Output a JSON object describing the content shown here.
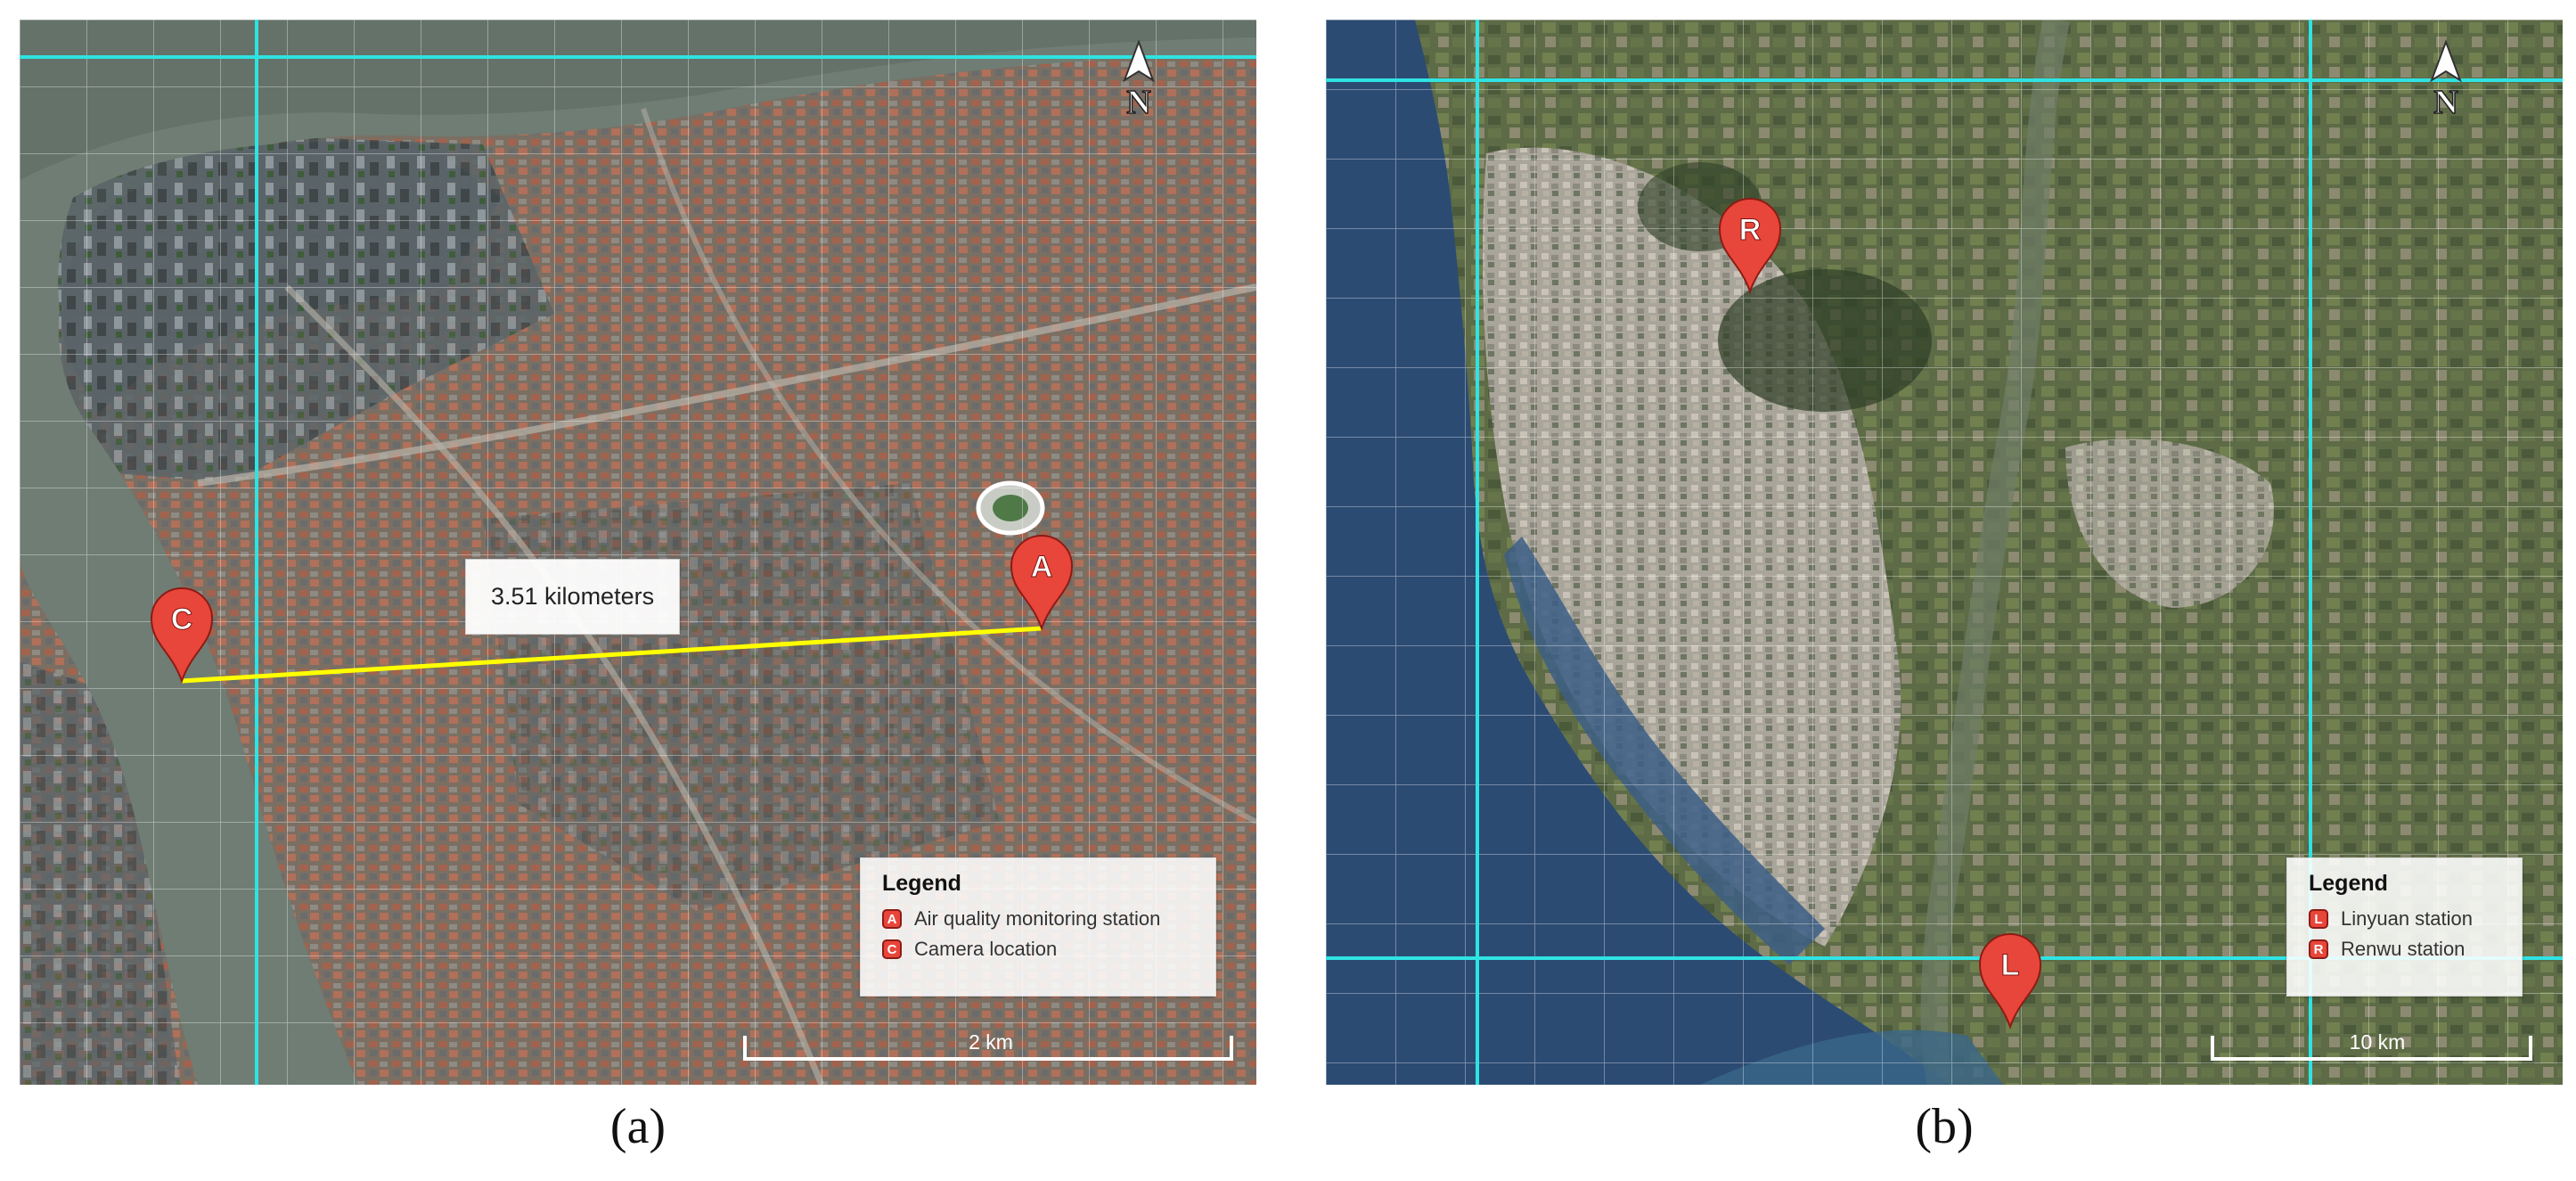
{
  "panels": {
    "a": {
      "caption": "(a)",
      "north_label": "N",
      "distance_label": "3.51 kilometers",
      "scale_label": "2 km",
      "legend": {
        "title": "Legend",
        "items": [
          {
            "key": "A",
            "label": "Air quality monitoring station"
          },
          {
            "key": "C",
            "label": "Camera location"
          }
        ]
      },
      "markers": {
        "station": "A",
        "camera": "C"
      }
    },
    "b": {
      "caption": "(b)",
      "north_label": "N",
      "scale_label": "10 km",
      "legend": {
        "title": "Legend",
        "items": [
          {
            "key": "L",
            "label": "Linyuan station"
          },
          {
            "key": "R",
            "label": "Renwu station"
          }
        ]
      },
      "markers": {
        "renwu": "R",
        "linyuan": "L"
      }
    }
  },
  "colors": {
    "marker": "#e8463b",
    "grid_major": "#2fe3e3",
    "distance_line": "#ffff00"
  }
}
